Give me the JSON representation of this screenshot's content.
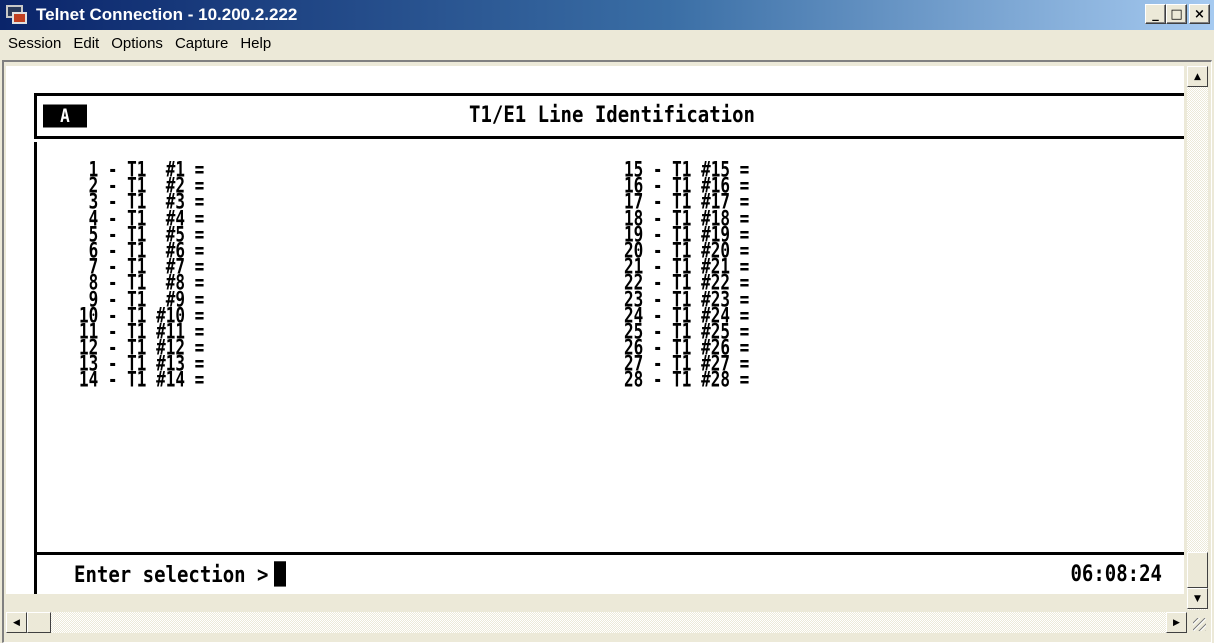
{
  "window": {
    "title": "Telnet Connection - 10.200.2.222",
    "minimize_glyph": "_",
    "maximize_glyph": "□",
    "close_glyph": "×"
  },
  "menu": [
    "Session",
    "Edit",
    "Options",
    "Capture",
    "Help"
  ],
  "terminal": {
    "page_badge": "A",
    "screen_title": "T1/E1 Line Identification",
    "left_column": [
      " 1 - T1  #1 =",
      " 2 - T1  #2 =",
      " 3 - T1  #3 =",
      " 4 - T1  #4 =",
      " 5 - T1  #5 =",
      " 6 - T1  #6 =",
      " 7 - T1  #7 =",
      " 8 - T1  #8 =",
      " 9 - T1  #9 =",
      "10 - T1 #10 =",
      "11 - T1 #11 =",
      "12 - T1 #12 =",
      "13 - T1 #13 =",
      "14 - T1 #14 ="
    ],
    "right_column": [
      "15 - T1 #15 =",
      "16 - T1 #16 =",
      "17 - T1 #17 =",
      "18 - T1 #18 =",
      "19 - T1 #19 =",
      "20 - T1 #20 =",
      "21 - T1 #21 =",
      "22 - T1 #22 =",
      "23 - T1 #23 =",
      "24 - T1 #24 =",
      "25 - T1 #25 =",
      "26 - T1 #26 =",
      "27 - T1 #27 =",
      "28 - T1 #28 ="
    ],
    "prompt": "Enter selection >",
    "clock": "06:08:24"
  },
  "icons": {
    "app": "telnet-computer-icon",
    "scroll_up": "▲",
    "scroll_down": "▼",
    "scroll_left": "◀",
    "scroll_right": "▶"
  }
}
